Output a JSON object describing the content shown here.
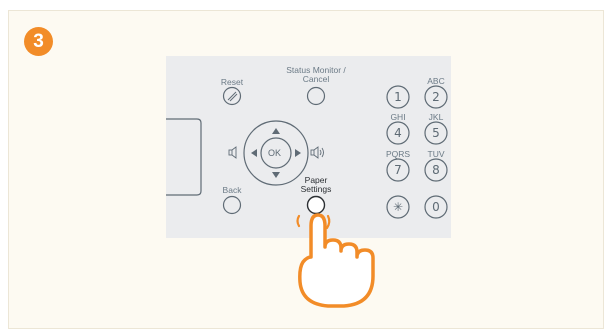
{
  "step": {
    "number": "3"
  },
  "panel": {
    "reset": {
      "label": "Reset",
      "icon": "reset-slash-icon"
    },
    "status_monitor": {
      "label_line1": "Status Monitor /",
      "label_line2": "Cancel"
    },
    "ok": {
      "label": "OK"
    },
    "back": {
      "label": "Back"
    },
    "paper_settings": {
      "label_line1": "Paper",
      "label_line2": "Settings"
    },
    "volume_down_icon": "speaker-low-icon",
    "volume_up_icon": "speaker-high-icon",
    "keypad": {
      "k1": {
        "digit": "1",
        "letters": ""
      },
      "k2": {
        "digit": "2",
        "letters": "ABC"
      },
      "k4": {
        "digit": "4",
        "letters": "GHI"
      },
      "k5": {
        "digit": "5",
        "letters": "JKL"
      },
      "k7": {
        "digit": "7",
        "letters": "PQRS"
      },
      "k8": {
        "digit": "8",
        "letters": "TUV"
      },
      "kstar": {
        "digit": "✳",
        "letters": ""
      },
      "k0": {
        "digit": "0",
        "letters": ""
      }
    }
  },
  "colors": {
    "accent": "#f28c28",
    "panel": "#ebecee",
    "frame": "#fdfaf2"
  }
}
